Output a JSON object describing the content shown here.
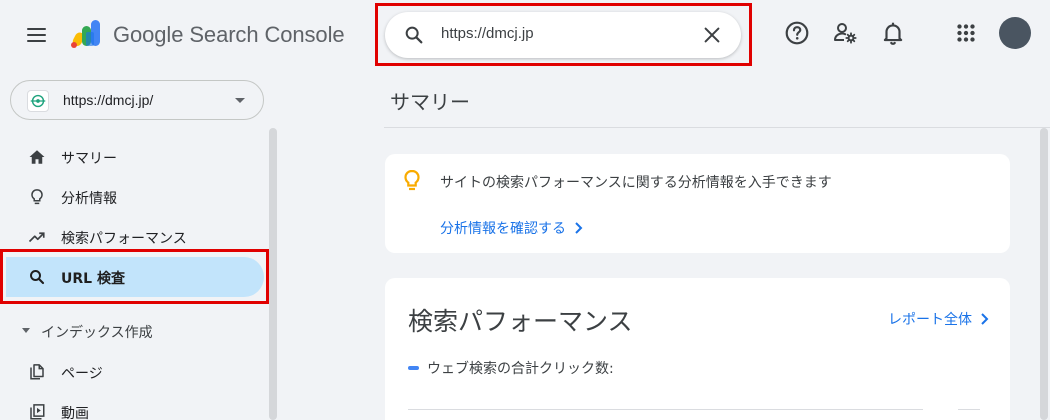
{
  "header": {
    "app_name": "Google Search Console",
    "search": {
      "value": "https://dmcj.jp"
    },
    "icons": [
      "menu-icon",
      "help-icon",
      "manage-users-icon",
      "notifications-icon",
      "apps-grid-icon",
      "search-icon",
      "close-icon"
    ],
    "avatar_color": "#4a5561"
  },
  "sidebar": {
    "property": "https://dmcj.jp/",
    "items": [
      {
        "label": "サマリー",
        "icon": "home-icon",
        "active": false
      },
      {
        "label": "分析情報",
        "icon": "lightbulb-icon",
        "active": false
      },
      {
        "label": "検索パフォーマンス",
        "icon": "trending-up-icon",
        "active": false
      },
      {
        "label": "URL 検査",
        "icon": "search-icon",
        "active": true
      }
    ],
    "section": {
      "label": "インデックス作成",
      "items": [
        {
          "label": "ページ",
          "icon": "pages-icon"
        },
        {
          "label": "動画",
          "icon": "video-icon"
        }
      ]
    }
  },
  "main": {
    "page_title": "サマリー",
    "insights_card": {
      "text": "サイトの検索パフォーマンスに関する分析情報を入手できます",
      "link": "分析情報を確認する"
    },
    "performance_card": {
      "title": "検索パフォーマンス",
      "link": "レポート全体",
      "legend": "ウェブ検索の合計クリック数:"
    }
  },
  "colors": {
    "highlight_frame": "#e00000",
    "active_nav_bg": "#c2e4fb",
    "link": "#1a73e8",
    "page_bg": "#f1f3f6"
  }
}
